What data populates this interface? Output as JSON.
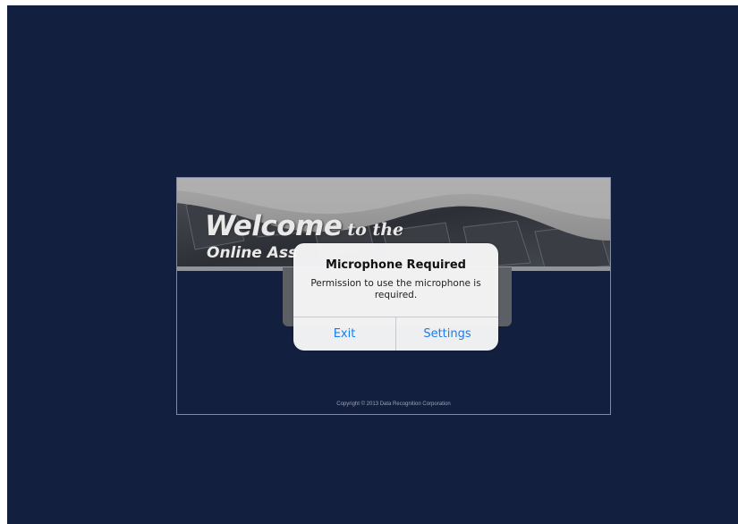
{
  "welcome": {
    "headline_big": "Welcome",
    "headline_small": "to the",
    "subline": "Online Ass"
  },
  "footer": {
    "copyright": "Copyright © 2013 Data Recognition Corporation"
  },
  "alert": {
    "title": "Microphone Required",
    "message": "Permission to use the microphone is required.",
    "buttons": {
      "exit": "Exit",
      "settings": "Settings"
    }
  },
  "colors": {
    "background": "#131f3f",
    "alert_button_text": "#1a7cf0"
  }
}
